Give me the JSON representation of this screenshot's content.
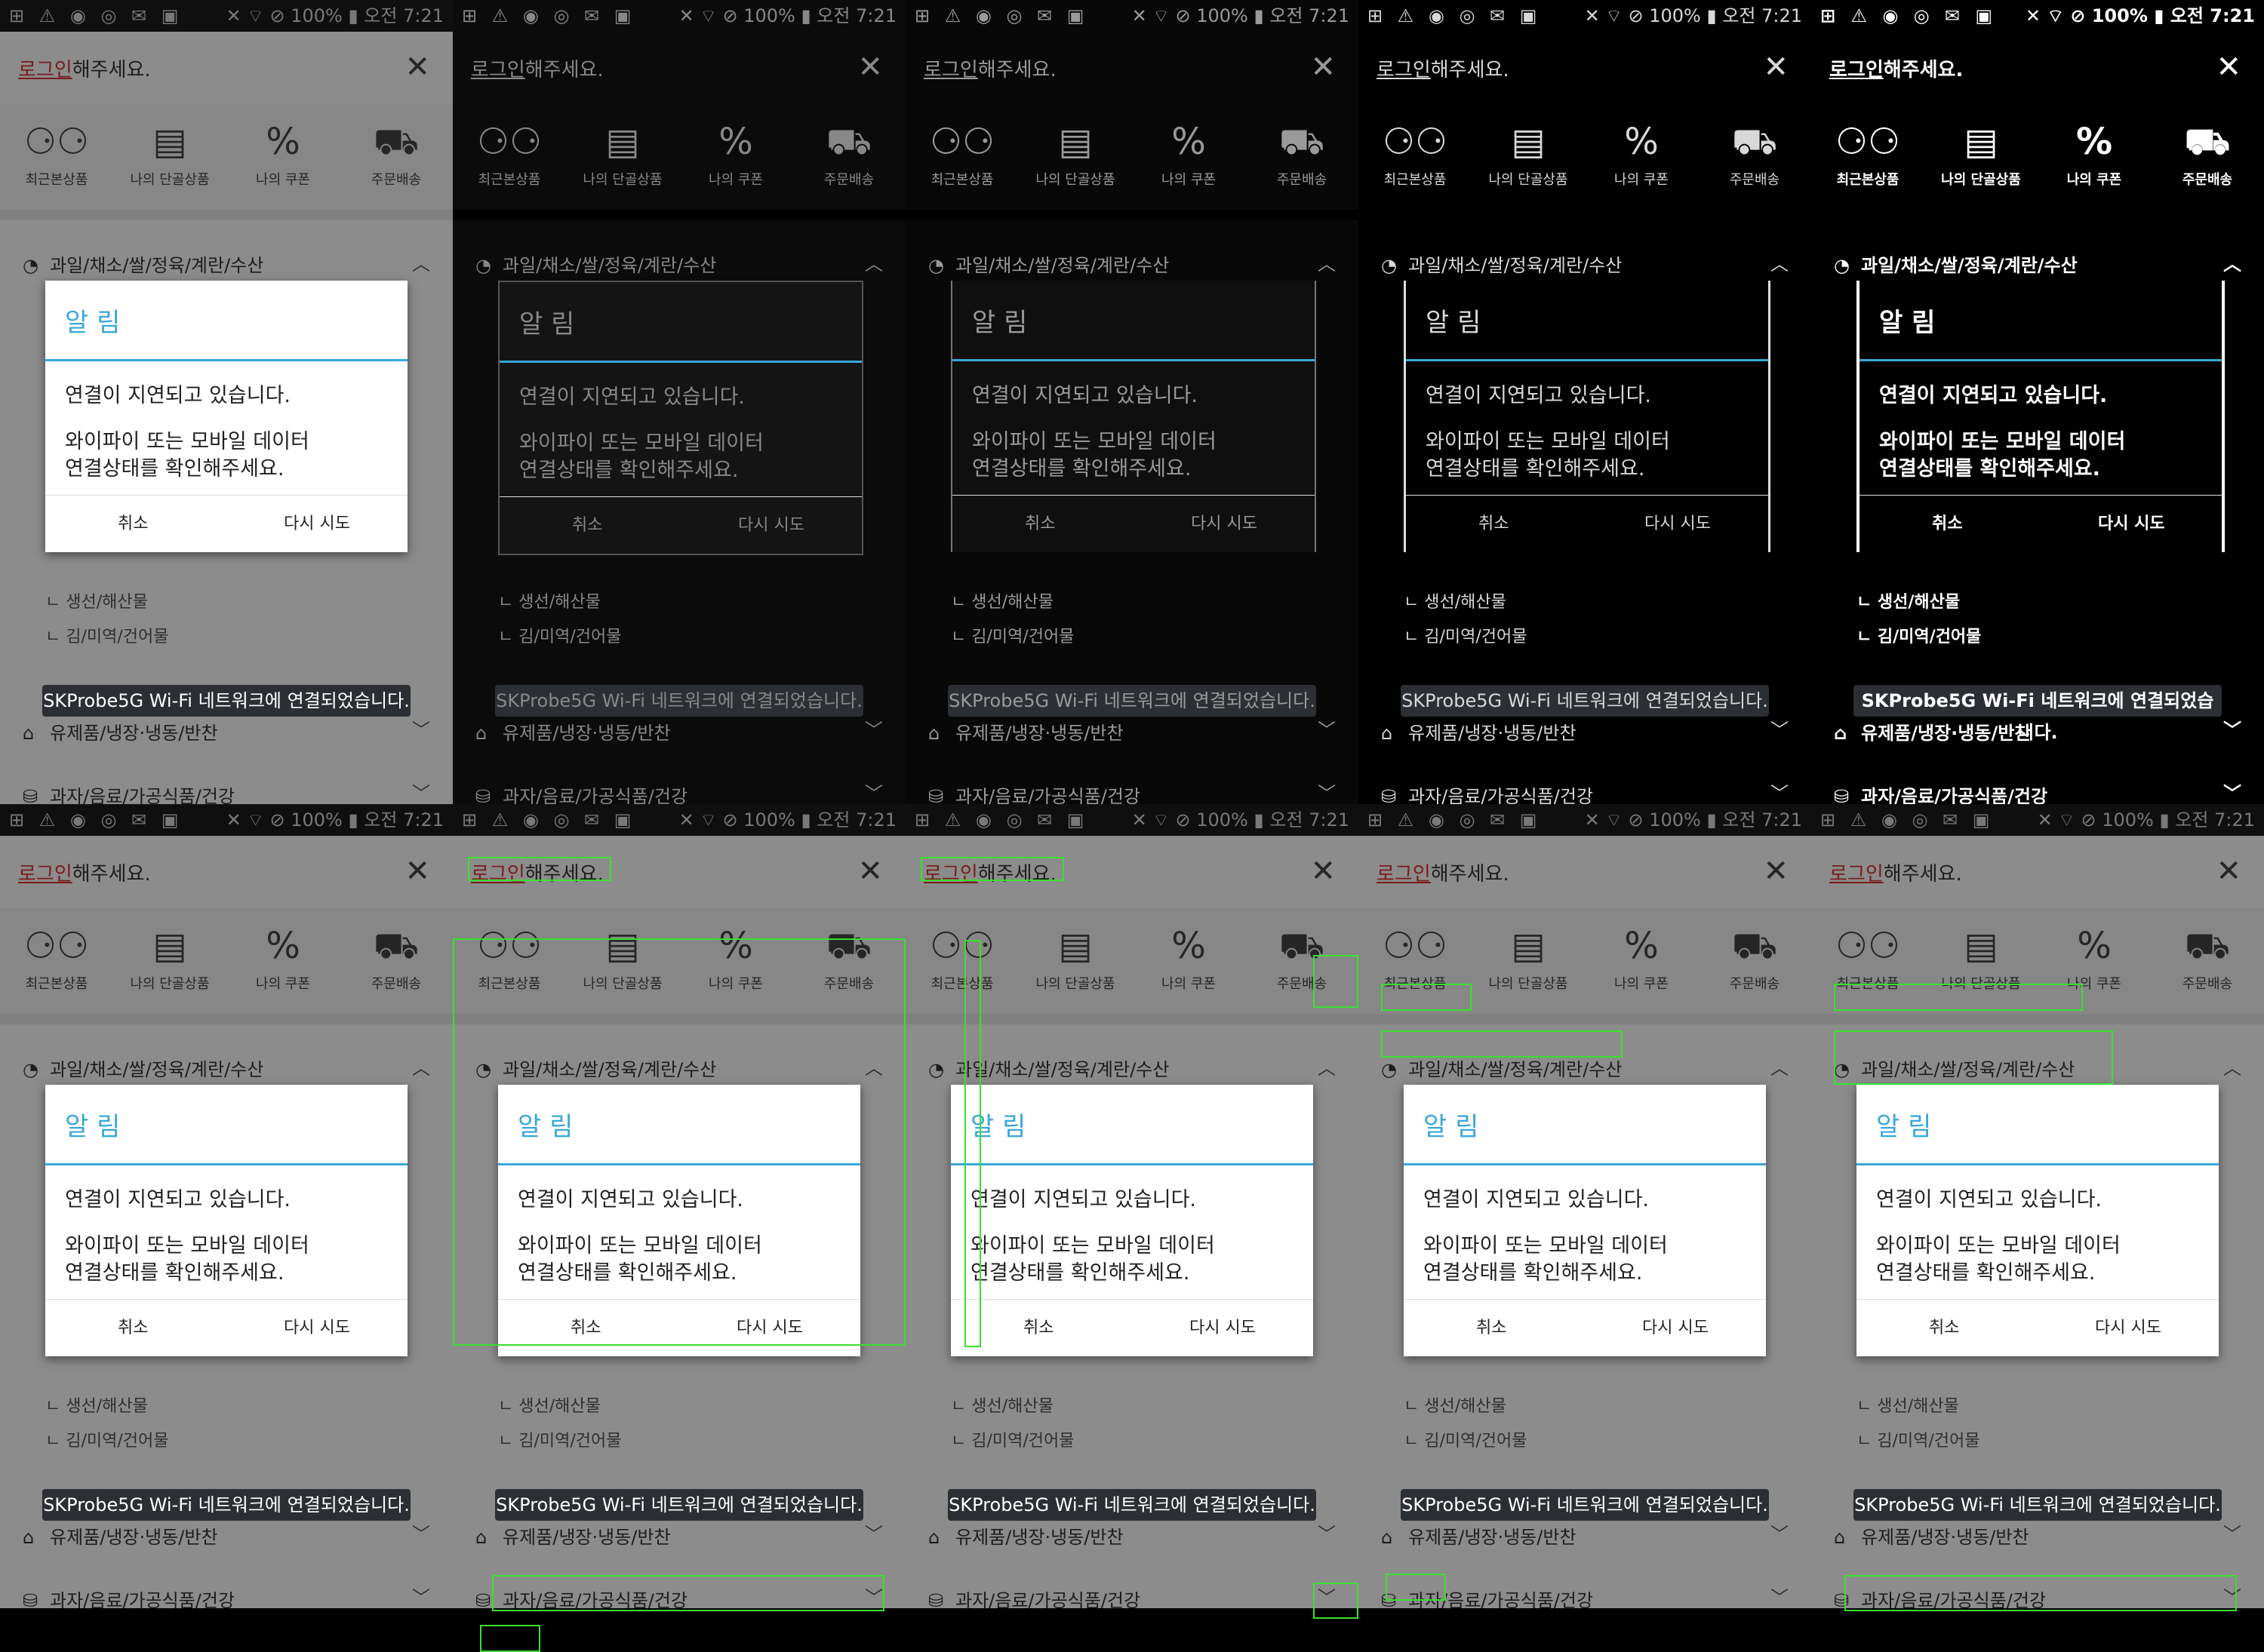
{
  "status_bar": {
    "left_icons": "⊞ ⚠ ◉ ◎ ✉ ▣",
    "right_text": "✕ ⌔ ⊘ 100% ▮ 오전 7:21"
  },
  "header": {
    "title_login": "로그인",
    "title_rest": "해주세요.",
    "close": "✕"
  },
  "menu": [
    {
      "icon": "⚆⚆",
      "label": "최근본상품"
    },
    {
      "icon": "▤",
      "label": "나의 단골상품"
    },
    {
      "icon": "%",
      "label": "나의 쿠폰"
    },
    {
      "icon": "⛟",
      "label": "주문배송"
    }
  ],
  "categories": [
    {
      "icon": "◔",
      "label": "과일/채소/쌀/정육/계란/수산",
      "chevron": "︿"
    },
    {
      "icon": "⌂",
      "label": "유제품/냉장·냉동/반찬",
      "chevron": "﹀"
    },
    {
      "icon": "⛁",
      "label": "과자/음료/가공식품/건강",
      "chevron": "﹀"
    }
  ],
  "subs": [
    {
      "label": "ㄴ 생선/해산물"
    },
    {
      "label": "ㄴ 김/미역/건어물"
    }
  ],
  "dialog": {
    "title": "알 림",
    "message1": "연결이 지연되고 있습니다.",
    "message2a": "와이파이 또는 모바일 데이터",
    "message2b": "연결상태를 확인해주세요.",
    "cancel": "취소",
    "retry": "다시 시도"
  },
  "toast": {
    "text": "SKProbe5G Wi-Fi 네트워크에 연결되었습니다."
  }
}
